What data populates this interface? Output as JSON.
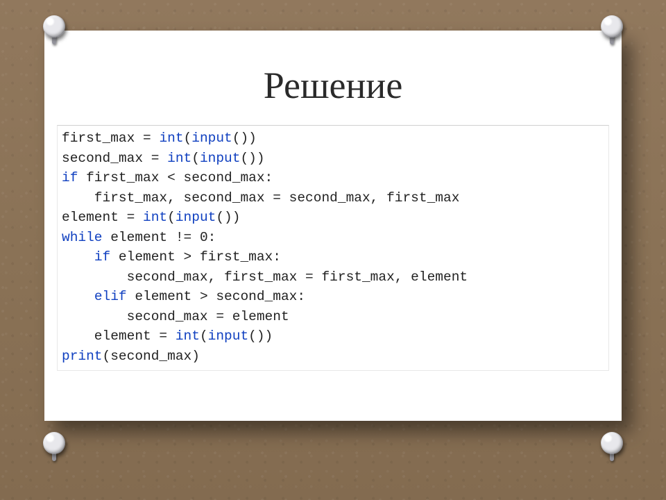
{
  "slide": {
    "title": "Решение",
    "code_lines": [
      [
        {
          "t": "first_max = "
        },
        {
          "t": "int",
          "kw": true
        },
        {
          "t": "("
        },
        {
          "t": "input",
          "kw": true
        },
        {
          "t": "())"
        }
      ],
      [
        {
          "t": "second_max = "
        },
        {
          "t": "int",
          "kw": true
        },
        {
          "t": "("
        },
        {
          "t": "input",
          "kw": true
        },
        {
          "t": "())"
        }
      ],
      [
        {
          "t": "if ",
          "kw": true
        },
        {
          "t": "first_max < second_max:"
        }
      ],
      [
        {
          "t": "    first_max, second_max = second_max, first_max"
        }
      ],
      [
        {
          "t": "element = "
        },
        {
          "t": "int",
          "kw": true
        },
        {
          "t": "("
        },
        {
          "t": "input",
          "kw": true
        },
        {
          "t": "())"
        }
      ],
      [
        {
          "t": "while ",
          "kw": true
        },
        {
          "t": "element != 0:"
        }
      ],
      [
        {
          "t": "    "
        },
        {
          "t": "if ",
          "kw": true
        },
        {
          "t": "element > first_max:"
        }
      ],
      [
        {
          "t": "        second_max, first_max = first_max, element"
        }
      ],
      [
        {
          "t": "    "
        },
        {
          "t": "elif ",
          "kw": true
        },
        {
          "t": "element > second_max:"
        }
      ],
      [
        {
          "t": "        second_max = element"
        }
      ],
      [
        {
          "t": "    element = "
        },
        {
          "t": "int",
          "kw": true
        },
        {
          "t": "("
        },
        {
          "t": "input",
          "kw": true
        },
        {
          "t": "())"
        }
      ],
      [
        {
          "t": "print",
          "kw": true
        },
        {
          "t": "(second_max)"
        }
      ]
    ]
  }
}
